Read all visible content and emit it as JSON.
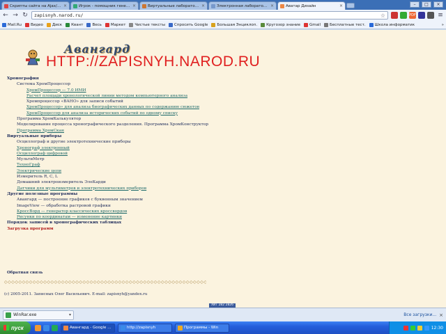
{
  "browser": {
    "tabs": [
      {
        "title": "Скрипты сайта на Ajax/PHP",
        "color": "#d44"
      },
      {
        "title": "Игрок - помощник генерато",
        "color": "#3a7"
      },
      {
        "title": "Виртуальные лаборатории",
        "color": "#c73"
      },
      {
        "title": "Электронная лаборатория",
        "color": "#79c"
      },
      {
        "title": "Аватар Дизайн",
        "color": "#e84",
        "active": true
      }
    ],
    "window_buttons": [
      "–",
      "□",
      "×"
    ],
    "url": "zapisnyh.narod.ru/",
    "extensions": [
      {
        "name": "ext-icon-1",
        "color": "#c33",
        "label": ""
      },
      {
        "name": "ext-icon-2",
        "color": "#3a3",
        "label": ""
      },
      {
        "name": "ext-icon-3",
        "color": "#e63",
        "label": "PDF"
      },
      {
        "name": "ext-icon-4",
        "color": "#339",
        "label": ""
      },
      {
        "name": "ext-icon-5",
        "color": "#555",
        "label": ""
      }
    ]
  },
  "bookmarks": [
    {
      "label": "Mail.Ru",
      "color": "#2a6ad8"
    },
    {
      "label": "Видео",
      "color": "#d33"
    },
    {
      "label": "Диск",
      "color": "#e8a21c"
    },
    {
      "label": "Квант",
      "color": "#2a8a3a"
    },
    {
      "label": "Весь",
      "color": "#3a6ac8"
    },
    {
      "label": "Маркет",
      "color": "#d33"
    },
    {
      "label": "Чистые тексты",
      "color": "#888"
    },
    {
      "label": "Спросить Google",
      "color": "#3a6ac8"
    },
    {
      "label": "Большая Энциклоп.",
      "color": "#d8a21c"
    },
    {
      "label": "Кругозор знание",
      "color": "#5a8a3a"
    },
    {
      "label": "Gmail",
      "color": "#d33"
    },
    {
      "label": "Бесплатные тест.",
      "color": "#777"
    },
    {
      "label": "Школа информатик",
      "color": "#2a6ad8"
    }
  ],
  "bookmarks_more": "»",
  "site": {
    "logo_word": "Авангард",
    "url_text": "HTTP://ZAPISNYH.NAROD.RU",
    "menu": [
      {
        "text": "Хронография",
        "style": "sec",
        "level": 0
      },
      {
        "text": "Система ХромПроцессор",
        "style": "txt",
        "level": 1
      },
      {
        "text": "ХромПроцессор — 7.0 ИМИ",
        "style": "lnk",
        "level": 2
      },
      {
        "text": "Расчет площади хронологической линии методом компьютерного анализа",
        "style": "lnk",
        "level": 2
      },
      {
        "text": "Хромпроцессор «ВАНО» для записи событий",
        "style": "txt",
        "level": 2
      },
      {
        "text": "ХромПроцессор» для анализа биографических данных по содержанию сюжетов",
        "style": "lnk",
        "level": 2
      },
      {
        "text": "ХромПроцессор для анализа исторических событий по одному списку",
        "style": "lnk",
        "level": 2
      },
      {
        "text": "Программа ХромКалькулятор",
        "style": "txt",
        "level": 1
      },
      {
        "text": "Моделирование процесса хронографического разделения. Программа ХромКонструктор",
        "style": "txt",
        "level": 1
      },
      {
        "text": "Программа ХромСкан",
        "style": "lnk",
        "level": 1
      },
      {
        "text": "Виртуальные приборы",
        "style": "sec",
        "level": 0
      },
      {
        "text": "Осциллограф и другие электротехнические приборы",
        "style": "txt",
        "level": 1
      },
      {
        "text": "Хронограф электронный",
        "style": "lnk",
        "level": 1
      },
      {
        "text": "Осциллограф цифровой",
        "style": "lnk",
        "level": 1
      },
      {
        "text": "МультиМетр",
        "style": "txt",
        "level": 1
      },
      {
        "text": "ТехноГраф",
        "style": "lnk",
        "level": 1
      },
      {
        "text": "Электрические цепи",
        "style": "lnk",
        "level": 1
      },
      {
        "text": "Измеритель R, C, L",
        "style": "txt",
        "level": 1
      },
      {
        "text": "Домашний электроизмеритель ЭлеКарди",
        "style": "txt",
        "level": 1
      },
      {
        "text": "Датчики для мультиметров и электротехнических приборов",
        "style": "lnk",
        "level": 1
      },
      {
        "text": "Другие полезные программы",
        "style": "sec",
        "level": 0
      },
      {
        "text": "Авангард — построение графиков с буквенным значением",
        "style": "txt",
        "level": 1
      },
      {
        "text": "ImageView — обработка растровой графики",
        "style": "txt",
        "level": 1
      },
      {
        "text": "КроссВорд — генератор классических кроссвордов",
        "style": "lnk",
        "level": 1
      },
      {
        "text": "Рисунки по координатам — изменение картинки",
        "style": "lnk",
        "level": 1
      },
      {
        "text": "Порядок записей в хронографических таблицах",
        "style": "sec",
        "level": 0
      },
      {
        "text": "Загрузка программ",
        "style": "red",
        "level": 0
      }
    ],
    "footnote": "Обратная связь",
    "ornament": "◇◇◇◇◇◇◇◇◇◇◇◇◇◇◇◇◇◇◇◇◇◇◇◇◇◇◇◇◇◇◇◇◇◇◇◇◇◇◇◇◇◇◇◇◇◇◇◇◇◇◇◇◇◇◇◇◇◇",
    "copyright": "(с) 2005-2011. Записных Олег Васильевич. E-mail: zapisnyh@yandex.ru",
    "counter": "ХИТ 282 2826"
  },
  "download_shelf": {
    "item_name": "WinRar.exe",
    "item_arrow": "▾",
    "show_all": "Все загрузки...",
    "close": "×"
  },
  "taskbar": {
    "start": "пуск",
    "quick_launch": [
      "#e93",
      "#3a8ae8",
      "#2a5"
    ],
    "buttons": [
      {
        "label": "Авангард - Google Chrome",
        "color": "#e84",
        "active": true
      },
      {
        "label": "http://zapisnyh",
        "color": "#3a8ae8"
      },
      {
        "label": "Программы - Win",
        "color": "#ea2"
      }
    ],
    "tray_icons": [
      "#e33",
      "#3c3",
      "#ec3",
      "#39f"
    ],
    "clock": "12:30"
  },
  "colors": {
    "page_bg": "#fbf3df",
    "link": "#1d6a6a",
    "heading": "#1c2a5a",
    "url_red": "#e02020"
  }
}
